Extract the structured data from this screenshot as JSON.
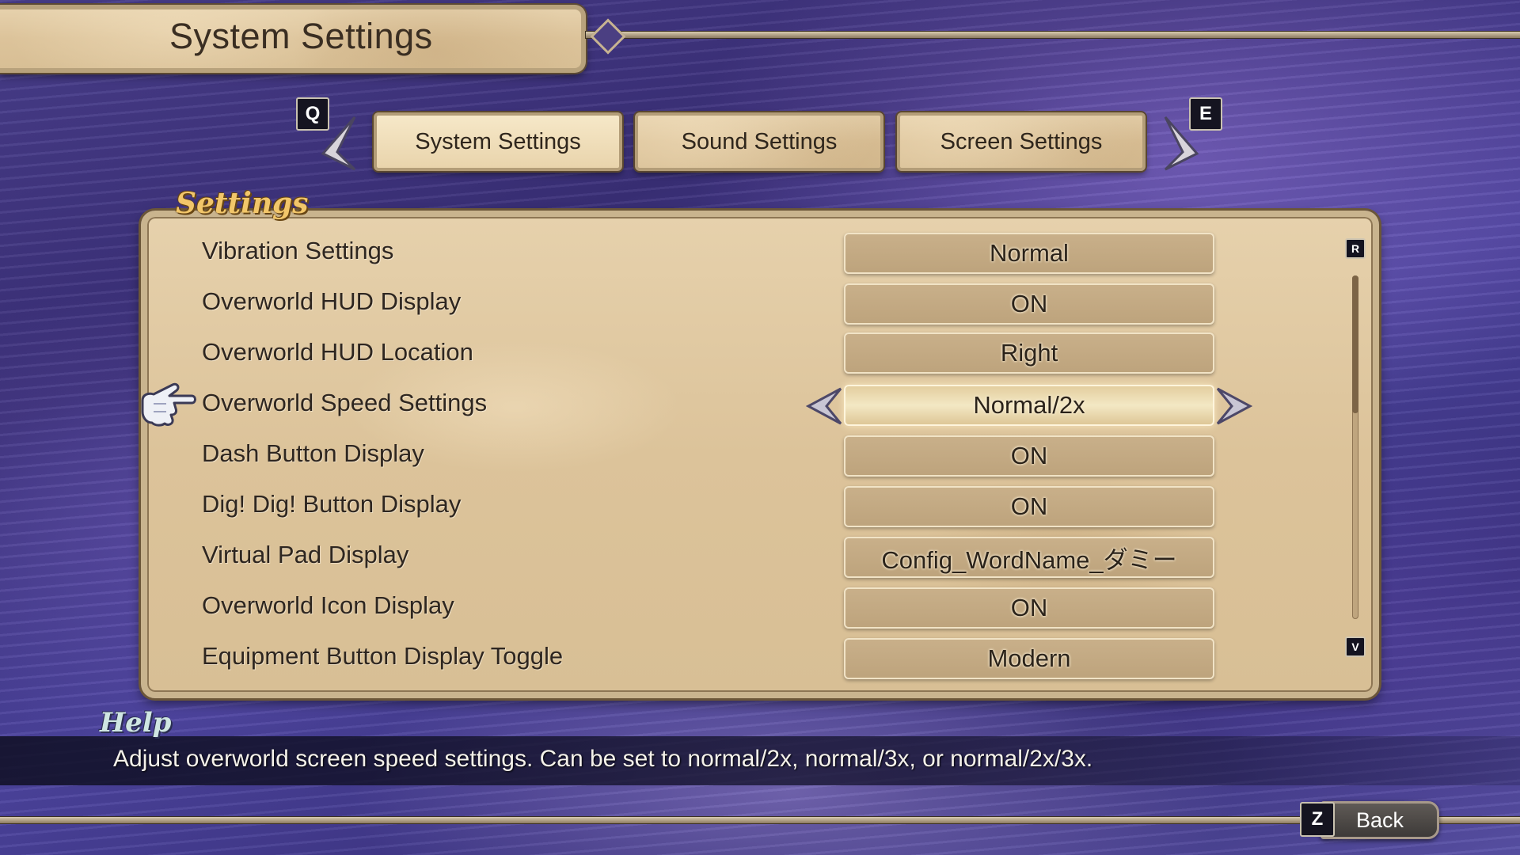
{
  "header": {
    "title": "System Settings"
  },
  "tabs": {
    "prev_key": "Q",
    "next_key": "E",
    "items": [
      {
        "label": "System Settings",
        "active": true
      },
      {
        "label": "Sound Settings",
        "active": false
      },
      {
        "label": "Screen Settings",
        "active": false
      }
    ]
  },
  "panel": {
    "heading": "Settings",
    "scroll_up_key": "R",
    "scroll_down_key": "V",
    "selected_index": 3,
    "rows": [
      {
        "label": "Vibration Settings",
        "value": "Normal"
      },
      {
        "label": "Overworld HUD Display",
        "value": "ON"
      },
      {
        "label": "Overworld HUD Location",
        "value": "Right"
      },
      {
        "label": "Overworld Speed Settings",
        "value": "Normal/2x"
      },
      {
        "label": "Dash Button Display",
        "value": "ON"
      },
      {
        "label": "Dig! Dig! Button Display",
        "value": "ON"
      },
      {
        "label": "Virtual Pad Display",
        "value": "Config_WordName_ダミー"
      },
      {
        "label": "Overworld Icon Display",
        "value": "ON"
      },
      {
        "label": "Equipment Button Display Toggle",
        "value": "Modern"
      }
    ]
  },
  "help": {
    "title": "Help",
    "text": "Adjust overworld screen speed settings. Can be set to normal/2x, normal/3x, or normal/2x/3x."
  },
  "footer": {
    "back_key": "Z",
    "back_label": "Back"
  },
  "icons": {
    "cursor": "pointing-hand-icon",
    "tab_prev": "chevron-left-icon",
    "tab_next": "chevron-right-icon",
    "value_prev": "chevron-left-icon",
    "value_next": "chevron-right-icon"
  },
  "colors": {
    "accent_gold": "#f2c66a",
    "parchment": "#dcc39a",
    "background": "#4a3f8e"
  }
}
